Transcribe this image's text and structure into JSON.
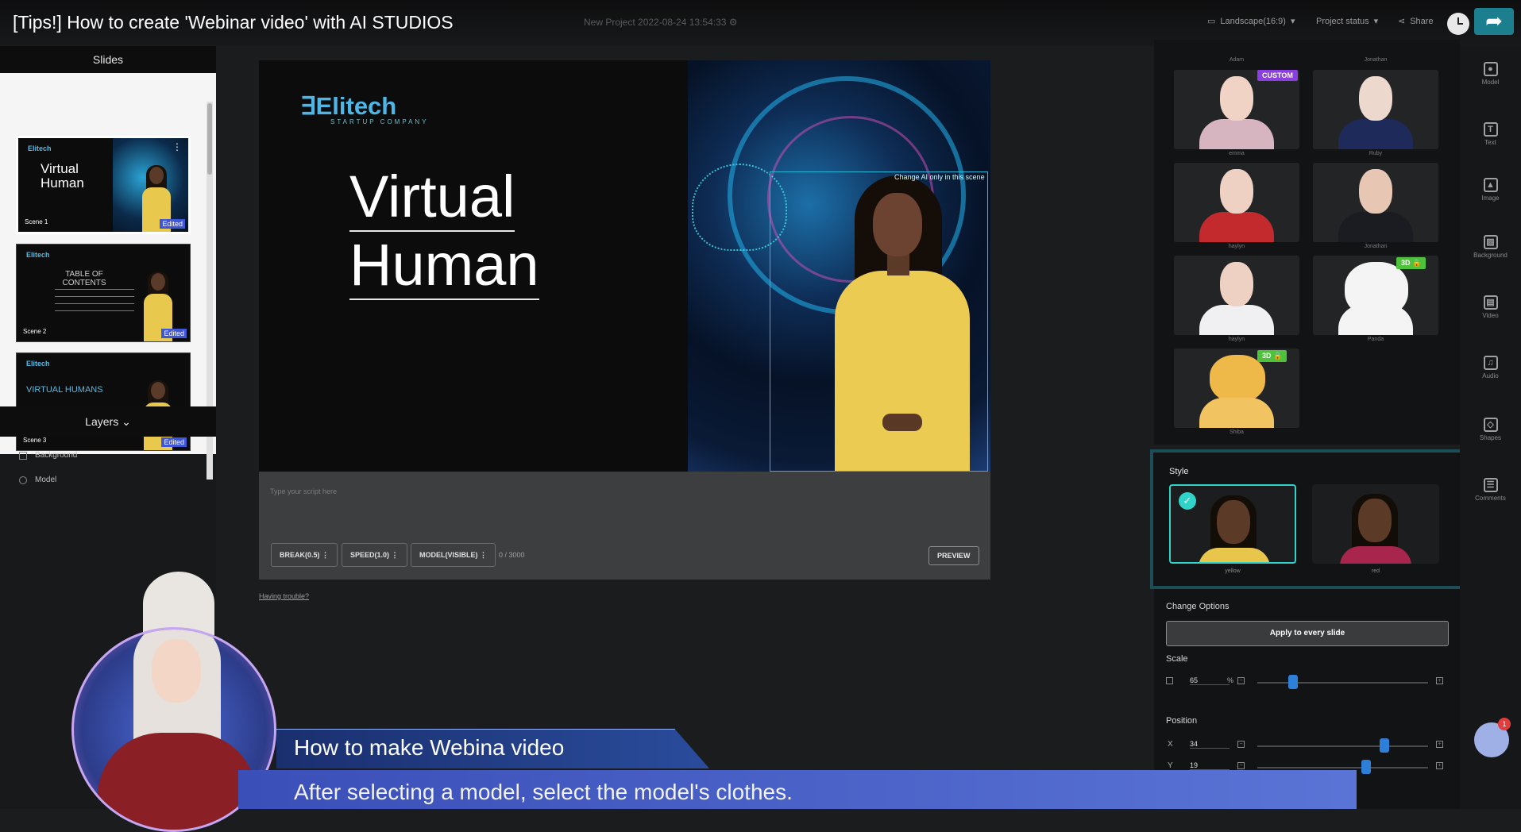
{
  "video": {
    "title": "[Tips!] How to create 'Webinar video' with AI STUDIOS"
  },
  "header": {
    "project_name": "New Project 2022-08-24 13:54:33",
    "aspect": "Landscape(16:9)",
    "project_status": "Project status",
    "share": "Share"
  },
  "slides": {
    "heading": "Slides",
    "items": [
      {
        "logo": "Elitech",
        "title": "Virtual Human",
        "scene": "Scene 1",
        "status": "Edited"
      },
      {
        "logo": "Elitech",
        "title": "TABLE OF CONTENTS",
        "scene": "Scene 2",
        "status": "Edited"
      },
      {
        "logo": "Elitech",
        "title": "VIRTUAL HUMANS",
        "scene": "Scene 3",
        "status": "Edited"
      }
    ]
  },
  "layers": {
    "heading": "Layers",
    "items": [
      "Background",
      "Model"
    ]
  },
  "canvas": {
    "logo": "Elitech",
    "logo_sub": "STARTUP COMPANY",
    "title_line1": "Virtual",
    "title_line2": "Human",
    "selection_hint": "Change AI only in this scene"
  },
  "script": {
    "placeholder": "Type your script here",
    "break_btn": "BREAK(0.5)",
    "speed_btn": "SPEED(1.0)",
    "model_btn": "MODEL(VISIBLE)",
    "char_count": "0 / 3000",
    "preview_btn": "PREVIEW",
    "help_link": "Having trouble?"
  },
  "models": {
    "top_names": [
      "Adam",
      "Jonathan"
    ],
    "items": [
      {
        "name": "emma",
        "badge": "CUSTOM"
      },
      {
        "name": "Ruby",
        "badge": ""
      },
      {
        "name": "haylyn",
        "badge": ""
      },
      {
        "name": "Jonathan",
        "badge": ""
      },
      {
        "name": "haylyn",
        "badge": ""
      },
      {
        "name": "Panda",
        "badge": "3D"
      },
      {
        "name": "Shiba",
        "badge": "3D"
      }
    ]
  },
  "style": {
    "heading": "Style",
    "options": [
      {
        "name": "yellow",
        "selected": true
      },
      {
        "name": "red",
        "selected": false
      }
    ]
  },
  "options": {
    "change_heading": "Change Options",
    "apply_btn": "Apply to every slide",
    "scale_label": "Scale",
    "scale_value": "65",
    "scale_unit": "%",
    "position_label": "Position",
    "x_label": "X",
    "x_value": "34",
    "y_label": "Y",
    "y_value": "19"
  },
  "rail": {
    "items": [
      "Model",
      "Text",
      "Image",
      "Background",
      "Video",
      "Audio",
      "Shapes",
      "Comments"
    ]
  },
  "chat": {
    "badge": "1"
  },
  "overlay": {
    "subtitle_title": "How to make Webina video",
    "subtitle_text": "After selecting a model, select the model's clothes."
  },
  "colors": {
    "accent": "#2fd3c8",
    "edited_badge": "#3f56d8",
    "custom_badge": "#8b3fe0",
    "badge_3d": "#4ec23a",
    "slider_knob": "#2e7fd8"
  }
}
